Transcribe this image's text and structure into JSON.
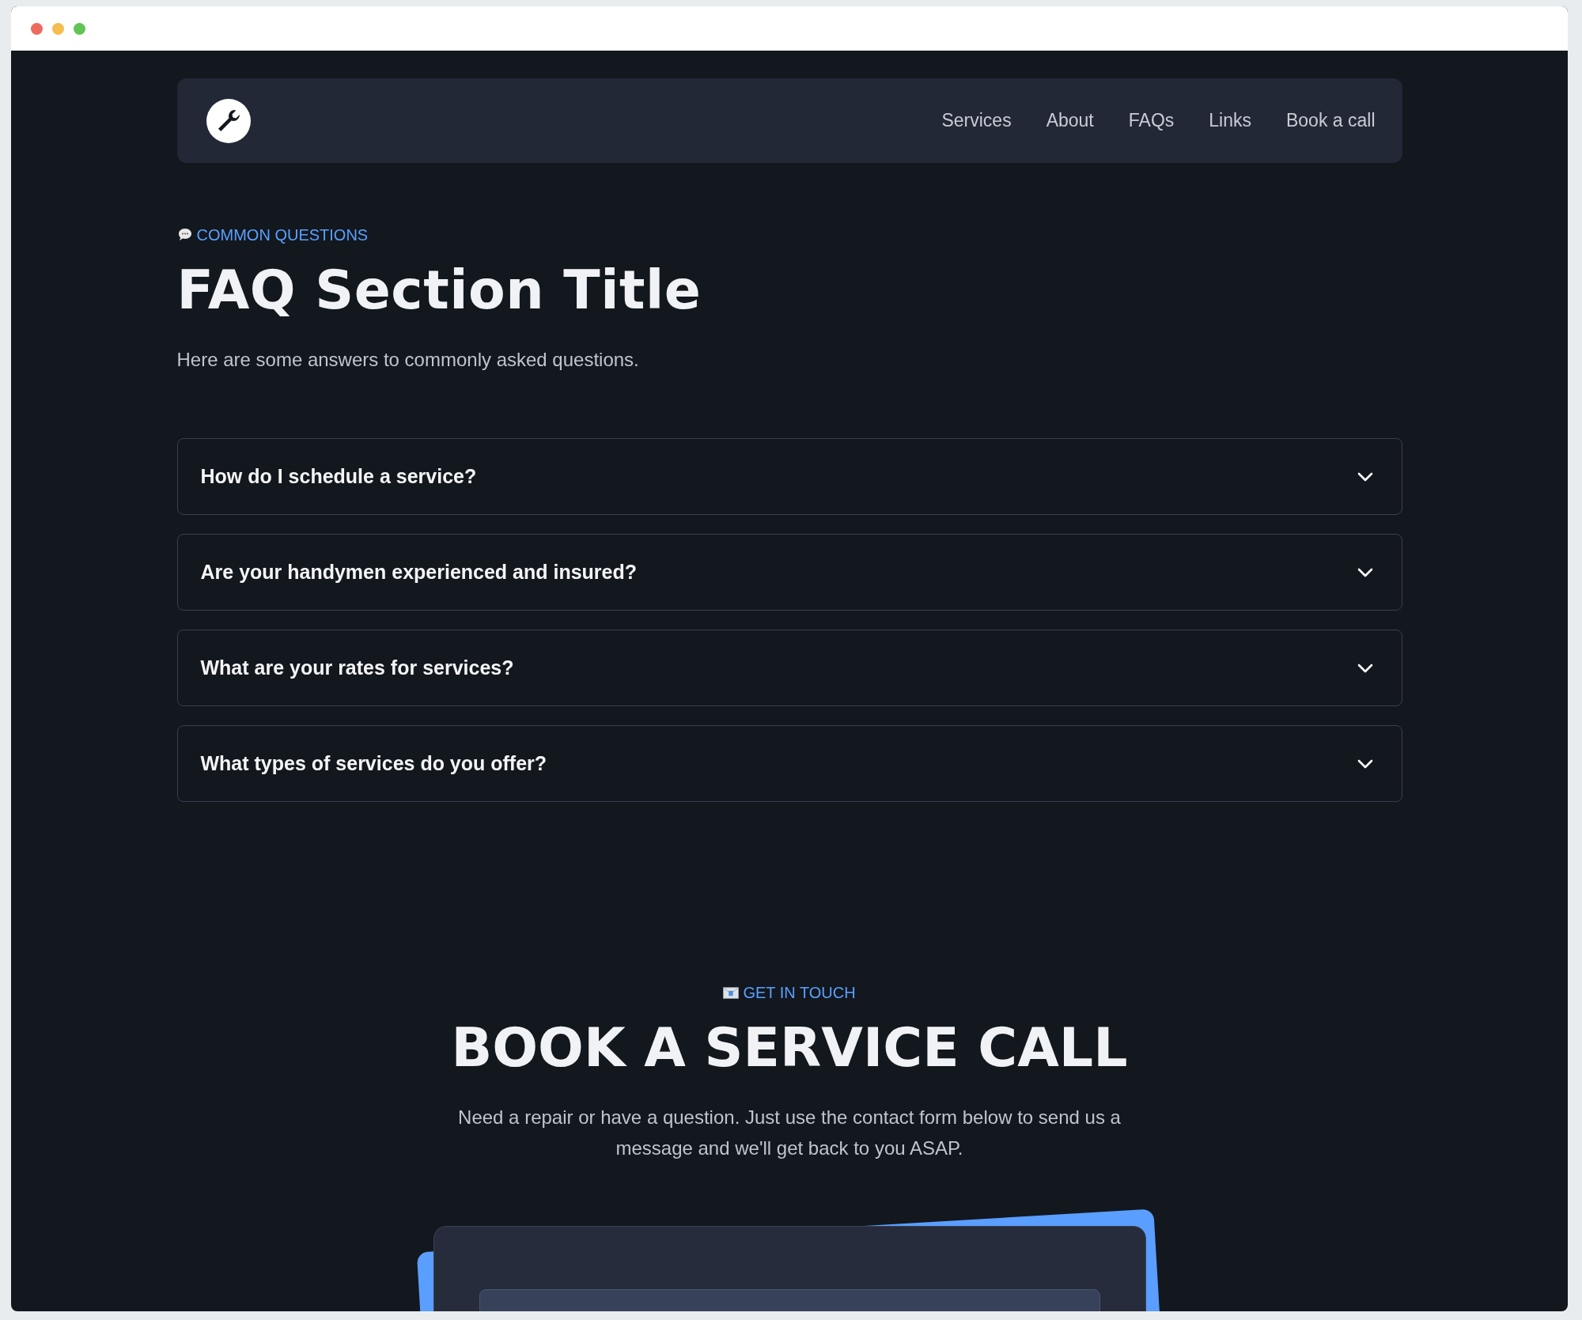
{
  "nav": {
    "links": [
      {
        "label": "Services"
      },
      {
        "label": "About"
      },
      {
        "label": "FAQs"
      },
      {
        "label": "Links"
      },
      {
        "label": "Book a call"
      }
    ]
  },
  "faq": {
    "eyebrow": "COMMON QUESTIONS",
    "title": "FAQ Section Title",
    "subtitle": "Here are some answers to commonly asked questions.",
    "items": [
      {
        "question": "How do I schedule a service?",
        "expanded": false
      },
      {
        "question": "Are your handymen experienced and insured?",
        "expanded": false
      },
      {
        "question": "What are your rates for services?",
        "expanded": false
      },
      {
        "question": "What types of services do you offer?",
        "expanded": false
      }
    ]
  },
  "contact": {
    "eyebrow": "GET IN TOUCH",
    "title": "BOOK A SERVICE CALL",
    "text": "Need a repair or have a question. Just use the contact form below to send us a message and we'll get back to you ASAP."
  }
}
